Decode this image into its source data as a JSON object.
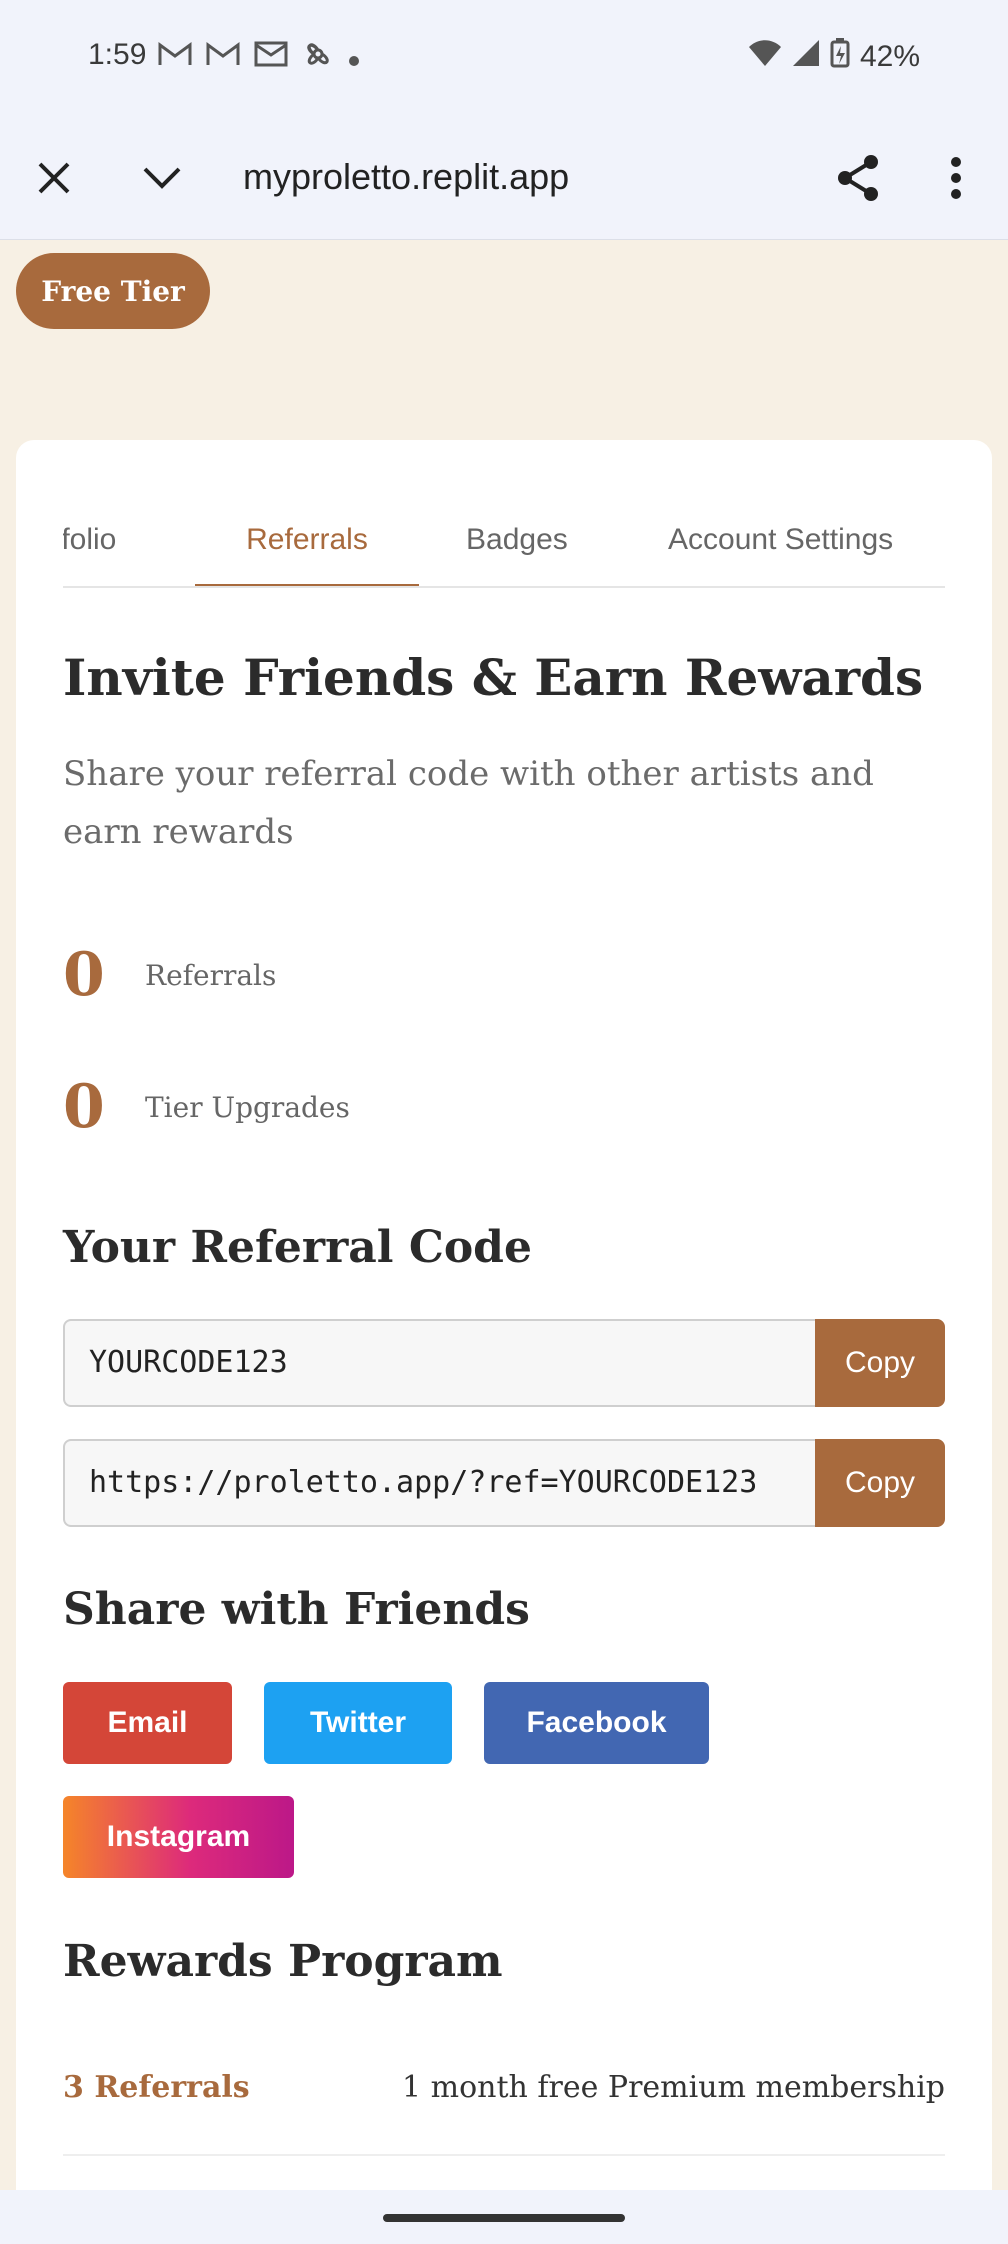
{
  "status_bar": {
    "time": "1:59",
    "battery": "42%",
    "icons_left": [
      "gmail-icon",
      "gmail-icon",
      "mail-icon",
      "pinwheel-icon",
      "dot-icon"
    ],
    "icons_right": [
      "wifi-icon",
      "signal-icon",
      "battery-icon"
    ]
  },
  "browser": {
    "url": "myproletto.replit.app"
  },
  "tier_badge": "Free Tier",
  "tabs": [
    {
      "label": "tfolio",
      "active": false
    },
    {
      "label": "Referrals",
      "active": true
    },
    {
      "label": "Badges",
      "active": false
    },
    {
      "label": "Account Settings",
      "active": false
    }
  ],
  "invite": {
    "title": "Invite Friends & Earn Rewards",
    "subtitle": "Share your referral code with other artists and earn rewards"
  },
  "stats": [
    {
      "value": "0",
      "label": "Referrals"
    },
    {
      "value": "0",
      "label": "Tier Upgrades"
    }
  ],
  "referral_code": {
    "title": "Your Referral Code",
    "code": "YOURCODE123",
    "link": "https://proletto.app/?ref=YOURCODE123",
    "copy_label": "Copy"
  },
  "share": {
    "title": "Share with Friends",
    "buttons": [
      {
        "label": "Email",
        "color": "#d44638"
      },
      {
        "label": "Twitter",
        "color": "#1da1f2"
      },
      {
        "label": "Facebook",
        "color": "#4267b2"
      },
      {
        "label": "Instagram",
        "color": "#e1306c"
      }
    ]
  },
  "rewards": {
    "title": "Rewards Program",
    "items": [
      {
        "requirement": "3 Referrals",
        "reward": "1 month free Premium membership"
      }
    ]
  },
  "colors": {
    "accent": "#a86a3d",
    "page_bg": "#f7f0e4",
    "chrome_bg": "#f1f3fb"
  }
}
